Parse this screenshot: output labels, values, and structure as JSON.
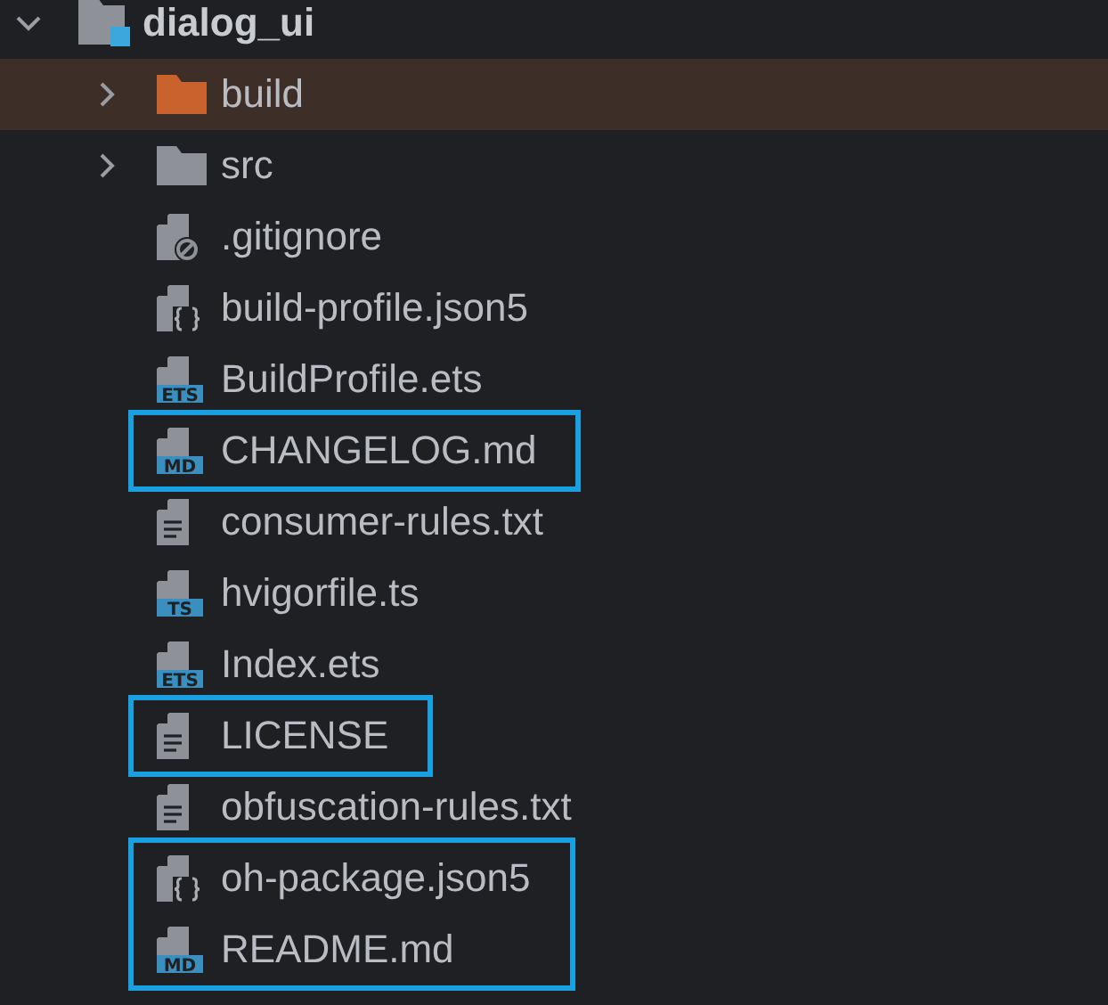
{
  "tree": {
    "name": "dialog_ui",
    "kind": "module",
    "expanded": true,
    "selected": false,
    "children": [
      {
        "name": "build",
        "kind": "excluded",
        "expanded": false,
        "selected": true,
        "outlined": false
      },
      {
        "name": "src",
        "kind": "folder",
        "expanded": false,
        "selected": false,
        "outlined": false
      },
      {
        "name": ".gitignore",
        "kind": "ignore",
        "selected": false,
        "outlined": false
      },
      {
        "name": "build-profile.json5",
        "kind": "json",
        "selected": false,
        "outlined": false
      },
      {
        "name": "BuildProfile.ets",
        "kind": "badged",
        "badge": "ETS",
        "selected": false,
        "outlined": false
      },
      {
        "name": "CHANGELOG.md",
        "kind": "badged",
        "badge": "MD",
        "selected": false,
        "outlined": true
      },
      {
        "name": "consumer-rules.txt",
        "kind": "text",
        "selected": false,
        "outlined": false
      },
      {
        "name": "hvigorfile.ts",
        "kind": "badged",
        "badge": "TS",
        "selected": false,
        "outlined": false
      },
      {
        "name": "Index.ets",
        "kind": "badged",
        "badge": "ETS",
        "selected": false,
        "outlined": false
      },
      {
        "name": "LICENSE",
        "kind": "text",
        "selected": false,
        "outlined": true
      },
      {
        "name": "obfuscation-rules.txt",
        "kind": "text",
        "selected": false,
        "outlined": false
      },
      {
        "name": "oh-package.json5",
        "kind": "json",
        "selected": false,
        "outlined": true
      },
      {
        "name": "README.md",
        "kind": "badged",
        "badge": "MD",
        "selected": false,
        "outlined": true
      }
    ]
  }
}
